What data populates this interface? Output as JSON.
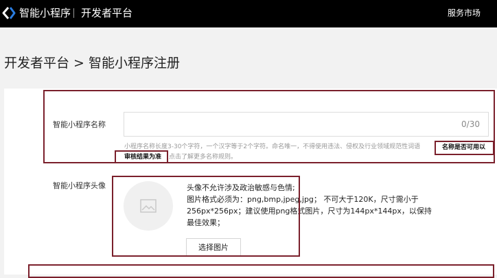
{
  "topbar": {
    "brand": "智能小程序",
    "platform": "开发者平台",
    "market_link": "服务市场",
    "logo_icon": "baidu-smart-app-logo-icon"
  },
  "breadcrumb": "开发者平台 > 智能小程序注册",
  "form": {
    "name": {
      "label": "智能小程序名称",
      "value": "",
      "counter": "0/30",
      "hint_line1": "小程序名称长度3-30个字符，一个汉字等于2个字符。命名唯一，不得使用违法、侵权及行业领域规范性词语",
      "hint_bold1": "名称是否可用以",
      "hint_bold2": "审核结果为准",
      "hint_line2": "点击了解更多名称规则。"
    },
    "avatar": {
      "label": "智能小程序头像",
      "placeholder_icon": "image-placeholder-icon",
      "desc_line1": "头像不允许涉及政治敏感与色情;",
      "desc_line2": "图片格式必须为：png,bmp,jpeg,jpg；  不可大于120K，尺寸需小于",
      "desc_line3": "256px*256px；建议使用png格式图片，尺寸为144px*144px，以保持",
      "desc_line4": "最佳效果；",
      "button": "选择图片"
    }
  },
  "colors": {
    "topbar": "#000000",
    "highlight": "#7a1f2b",
    "page_bg": "#f2f2f2"
  }
}
